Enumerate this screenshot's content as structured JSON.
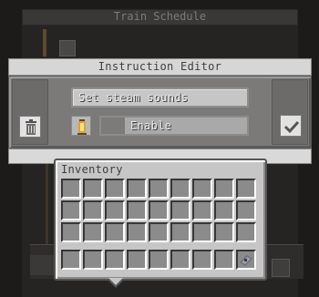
{
  "background": {
    "schedule_title": "Train Schedule"
  },
  "editor": {
    "title": "Instruction Editor",
    "instruction_value": "Set steam sounds",
    "toggle_label": "Enable",
    "item_icon": "lantern-icon"
  },
  "inventory": {
    "title": "Inventory",
    "main_rows": 3,
    "columns": 9,
    "hotbar_item": "item-icon"
  }
}
